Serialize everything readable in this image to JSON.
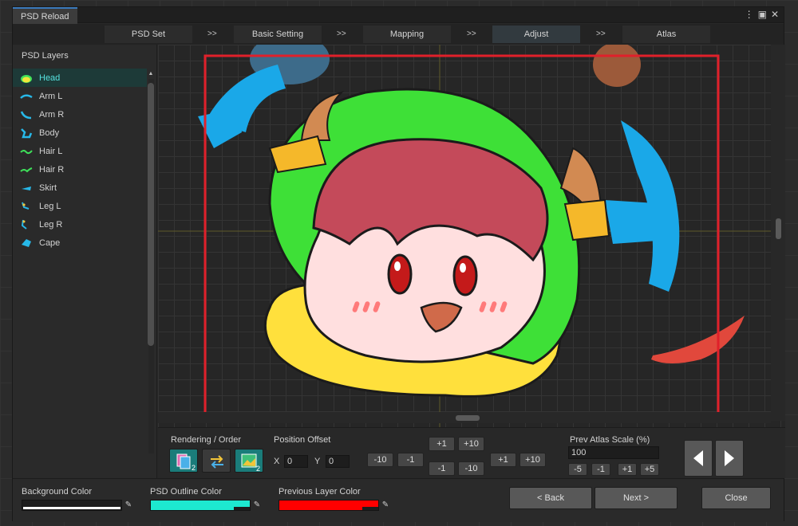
{
  "window": {
    "title": "PSD Reload"
  },
  "steps": [
    {
      "label": "PSD Set"
    },
    {
      "label": "Basic Setting"
    },
    {
      "label": "Mapping"
    },
    {
      "label": "Adjust"
    },
    {
      "label": "Atlas"
    }
  ],
  "step_separator": ">>",
  "layers_panel": {
    "title": "PSD Layers",
    "items": [
      {
        "label": "Head",
        "selected": true,
        "color": "#f2e63a"
      },
      {
        "label": "Arm L",
        "color": "#27b8e8"
      },
      {
        "label": "Arm R",
        "color": "#27b8e8"
      },
      {
        "label": "Body",
        "color": "#27b8e8"
      },
      {
        "label": "Hair L",
        "color": "#3ee05a"
      },
      {
        "label": "Hair R",
        "color": "#3ee05a"
      },
      {
        "label": "Skirt",
        "color": "#27b8e8"
      },
      {
        "label": "Leg L",
        "color": "#f2c53a"
      },
      {
        "label": "Leg R",
        "color": "#27b8e8"
      },
      {
        "label": "Cape",
        "color": "#27b8e8"
      }
    ]
  },
  "controls": {
    "rendering_order_label": "Rendering / Order",
    "position_offset_label": "Position Offset",
    "x_label": "X",
    "y_label": "Y",
    "x_value": "0",
    "y_value": "0",
    "step_buttons": {
      "minus10_x": "-10",
      "minus1_x": "-1",
      "plus1_up": "+1",
      "plus10_up": "+10",
      "minus1_down": "-1",
      "minus10_down": "-10",
      "plus1_x": "+1",
      "plus10_x": "+10"
    },
    "prev_atlas_scale_label": "Prev Atlas Scale (%)",
    "prev_atlas_scale_value": "100",
    "scale_buttons": [
      "-5",
      "-1",
      "+1",
      "+5"
    ]
  },
  "bottom": {
    "background_color_label": "Background Color",
    "psd_outline_color_label": "PSD Outline Color",
    "previous_layer_color_label": "Previous Layer Color",
    "background_color": "#ffffff",
    "outline_color": "#1de9d0",
    "previous_layer_color": "#ff0000",
    "back_label": "< Back",
    "next_label": "Next >",
    "close_label": "Close"
  },
  "colors": {
    "accent_selected": "#56e3e0",
    "selection_frame": "#e0202a"
  }
}
